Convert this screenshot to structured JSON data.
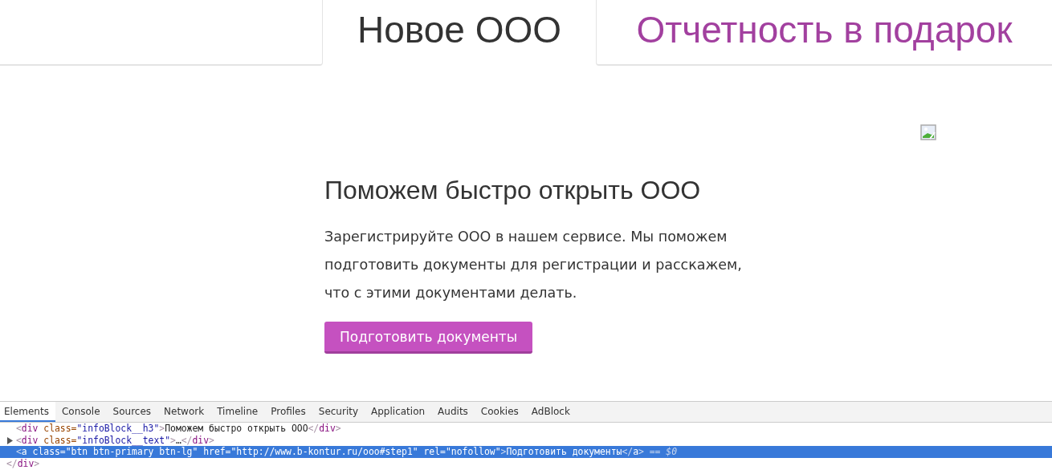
{
  "tabs": [
    {
      "label": "Новое ООО",
      "selected": true
    },
    {
      "label": "Отчетность в подарок",
      "selected": false
    }
  ],
  "content": {
    "heading": "Поможем быстро открыть ООО",
    "text": "Зарегистрируйте ООО в нашем сервисе. Мы поможем подготовить документы для регистрации и расскажем, что с этими документами делать.",
    "button": "Подготовить документы"
  },
  "devtools": {
    "tabs": [
      {
        "label": "Elements",
        "selected": true
      },
      {
        "label": "Console",
        "selected": false
      },
      {
        "label": "Sources",
        "selected": false
      },
      {
        "label": "Network",
        "selected": false
      },
      {
        "label": "Timeline",
        "selected": false
      },
      {
        "label": "Profiles",
        "selected": false
      },
      {
        "label": "Security",
        "selected": false
      },
      {
        "label": "Application",
        "selected": false
      },
      {
        "label": "Audits",
        "selected": false
      },
      {
        "label": "Cookies",
        "selected": false
      },
      {
        "label": "AdBlock",
        "selected": false
      }
    ],
    "lines": [
      {
        "expandable": false,
        "selected": false,
        "tokens": [
          {
            "kind": "punct",
            "text": "<"
          },
          {
            "kind": "tag",
            "text": "div"
          },
          {
            "kind": "attr",
            "text": " class="
          },
          {
            "kind": "value",
            "text": "\"infoBlock__h3\""
          },
          {
            "kind": "punct",
            "text": ">"
          },
          {
            "kind": "text",
            "text": "Поможем быстро открыть ООО"
          },
          {
            "kind": "punct",
            "text": "</"
          },
          {
            "kind": "tag",
            "text": "div"
          },
          {
            "kind": "punct",
            "text": ">"
          }
        ]
      },
      {
        "expandable": true,
        "selected": false,
        "tokens": [
          {
            "kind": "punct",
            "text": "<"
          },
          {
            "kind": "tag",
            "text": "div"
          },
          {
            "kind": "attr",
            "text": " class="
          },
          {
            "kind": "value",
            "text": "\"infoBlock__text\""
          },
          {
            "kind": "punct",
            "text": ">"
          },
          {
            "kind": "text",
            "text": "…"
          },
          {
            "kind": "punct",
            "text": "</"
          },
          {
            "kind": "tag",
            "text": "div"
          },
          {
            "kind": "punct",
            "text": ">"
          }
        ]
      },
      {
        "expandable": false,
        "selected": true,
        "tokens": [
          {
            "kind": "punct",
            "text": "<"
          },
          {
            "kind": "tag",
            "text": "a"
          },
          {
            "kind": "attr",
            "text": " class="
          },
          {
            "kind": "value",
            "text": "\"btn btn-primary btn-lg\""
          },
          {
            "kind": "attr",
            "text": " href="
          },
          {
            "kind": "value",
            "text": "\"http://www.b-kontur.ru/ooo#step1\""
          },
          {
            "kind": "attr",
            "text": " rel="
          },
          {
            "kind": "value",
            "text": "\"nofollow\""
          },
          {
            "kind": "punct",
            "text": ">"
          },
          {
            "kind": "text",
            "text": "Подготовить документы"
          },
          {
            "kind": "punct",
            "text": "</"
          },
          {
            "kind": "tag",
            "text": "a"
          },
          {
            "kind": "punct",
            "text": ">"
          },
          {
            "kind": "ref",
            "text": " == $0"
          }
        ]
      },
      {
        "expandable": false,
        "selected": false,
        "tokens": [
          {
            "kind": "punct",
            "text": "</"
          },
          {
            "kind": "tag",
            "text": "div"
          },
          {
            "kind": "punct",
            "text": ">"
          }
        ]
      }
    ]
  }
}
